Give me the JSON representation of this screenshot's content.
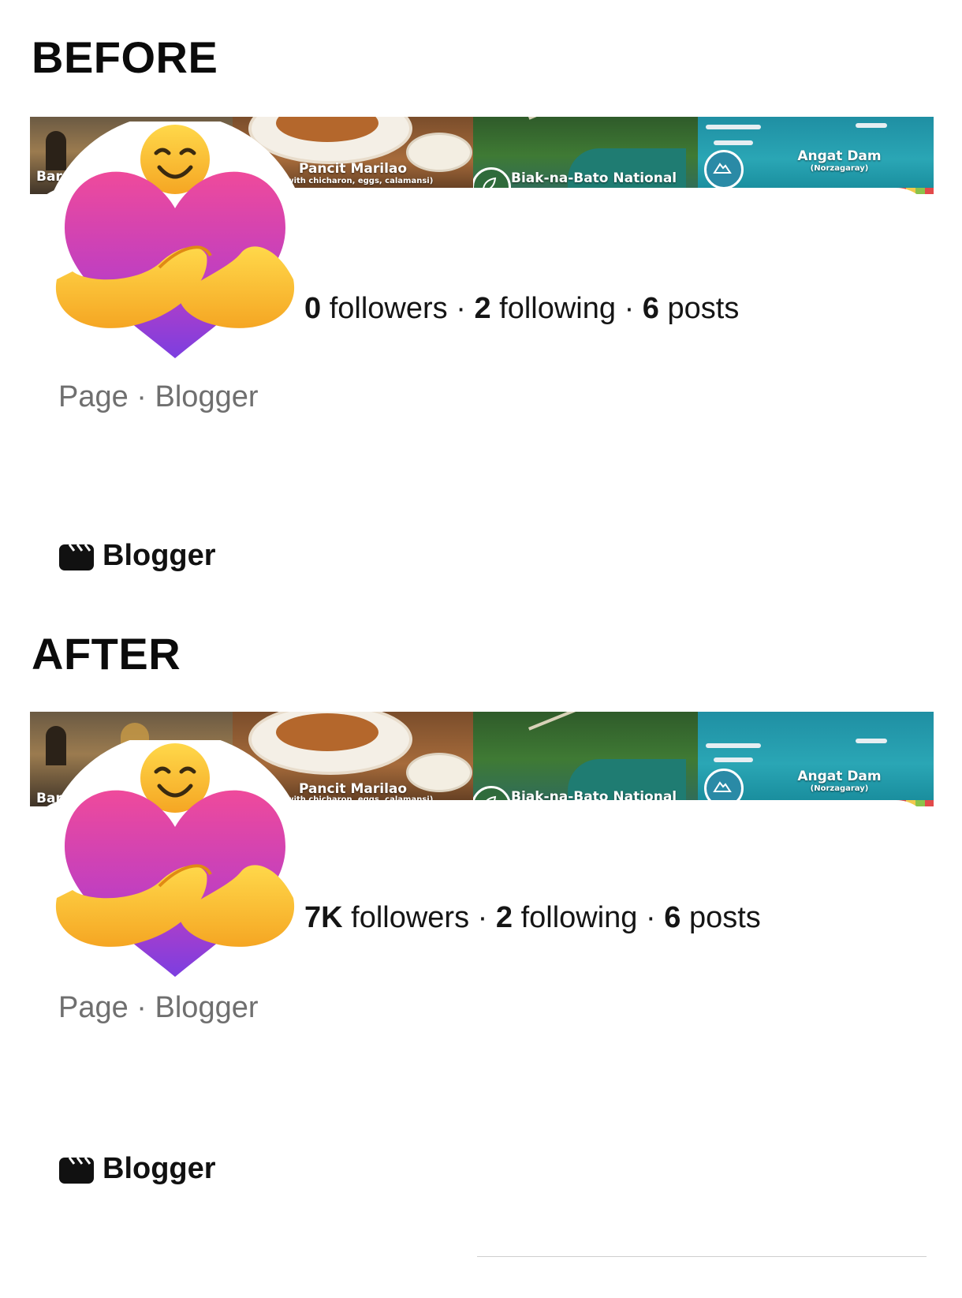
{
  "before": {
    "heading": "BEFORE",
    "cover": {
      "tiles": [
        {
          "caption": "Baras",
          "icon": "church-photo"
        },
        {
          "caption": "Pancit Marilao",
          "sub": "cit with chicharon, eggs, calamansi)",
          "icon": "food-photo"
        },
        {
          "caption": "Biak-na-Bato National Park",
          "icon": "leaf-badge-icon"
        },
        {
          "caption": "Angat Dam",
          "sub": "(Norzagaray)",
          "icon": "mountain-badge-icon"
        }
      ]
    },
    "avatar_icon": "hugging-heart-emoji",
    "stats": {
      "followers_count": "0",
      "followers_label": "followers",
      "following_count": "2",
      "following_label": "following",
      "posts_count": "6",
      "posts_label": "posts",
      "separator": "·"
    },
    "subtitle": "Page · Blogger",
    "category": "Blogger",
    "category_icon": "clapperboard-icon"
  },
  "after": {
    "heading": "AFTER",
    "cover": {
      "tiles": [
        {
          "caption": "Baras",
          "icon": "church-photo"
        },
        {
          "caption": "Pancit Marilao",
          "sub": "cit with chicharon, eggs, calamansi)",
          "icon": "food-photo"
        },
        {
          "caption": "Biak-na-Bato National Park",
          "icon": "leaf-badge-icon"
        },
        {
          "caption": "Angat Dam",
          "sub": "(Norzagaray)",
          "icon": "mountain-badge-icon"
        }
      ]
    },
    "avatar_icon": "hugging-heart-emoji",
    "stats": {
      "followers_count": "7K",
      "followers_label": "followers",
      "following_count": "2",
      "following_label": "following",
      "posts_count": "6",
      "posts_label": "posts",
      "separator": "·"
    },
    "subtitle": "Page · Blogger",
    "category": "Blogger",
    "category_icon": "clapperboard-icon"
  },
  "colors": {
    "text": "#111111",
    "muted": "#6f6f6f",
    "heart_pink": "#e0409a",
    "heart_purple": "#8a3fd6",
    "hands_yellow": "#f6c23a"
  }
}
